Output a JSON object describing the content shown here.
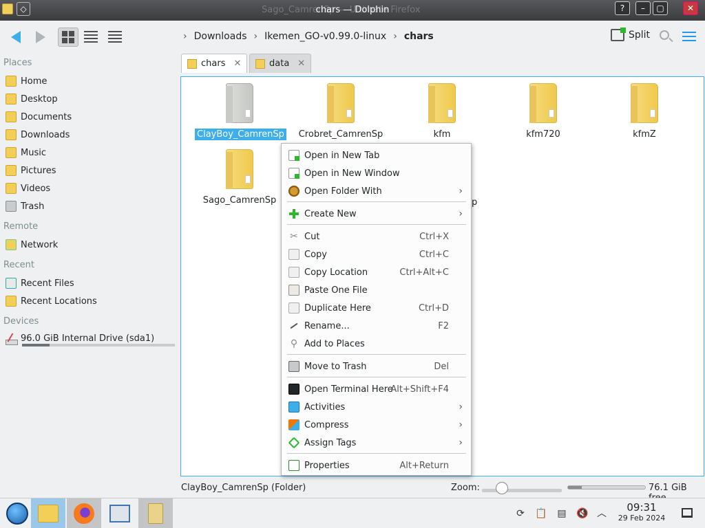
{
  "window": {
    "title": "chars — Dolphin",
    "ghost_title": "Sago_CamrenSp — Ultimate Firefox",
    "pin_label": "◇",
    "help_label": "?",
    "min_label": "–",
    "max_label": "▢",
    "close_label": "✕"
  },
  "toolbar": {
    "breadcrumbs": [
      "Downloads",
      "Ikemen_GO-v0.99.0-linux",
      "chars"
    ],
    "crumb_separator": "›",
    "split_label": "Split"
  },
  "sidebar": {
    "places_header": "Places",
    "places": [
      {
        "label": "Home",
        "icon": "home-folder-icon"
      },
      {
        "label": "Desktop",
        "icon": "desktop-folder-icon"
      },
      {
        "label": "Documents",
        "icon": "documents-folder-icon"
      },
      {
        "label": "Downloads",
        "icon": "downloads-folder-icon"
      },
      {
        "label": "Music",
        "icon": "music-folder-icon"
      },
      {
        "label": "Pictures",
        "icon": "pictures-folder-icon"
      },
      {
        "label": "Videos",
        "icon": "videos-folder-icon"
      },
      {
        "label": "Trash",
        "icon": "trash-icon"
      }
    ],
    "remote_header": "Remote",
    "remote": [
      {
        "label": "Network",
        "icon": "network-folder-icon"
      }
    ],
    "recent_header": "Recent",
    "recent": [
      {
        "label": "Recent Files",
        "icon": "recent-files-icon"
      },
      {
        "label": "Recent Locations",
        "icon": "recent-locations-icon"
      }
    ],
    "devices_header": "Devices",
    "devices": [
      {
        "label": "96.0 GiB Internal Drive (sda1)",
        "icon": "drive-icon",
        "usage_fraction": 0.18
      }
    ]
  },
  "tabs": [
    {
      "label": "chars",
      "active": true,
      "close": "✕"
    },
    {
      "label": "data",
      "active": false,
      "close": "✕"
    }
  ],
  "files": [
    {
      "name": "ClayBoy_CamrenSp",
      "selected": true
    },
    {
      "name": "Crobret_CamrenSp",
      "selected": false
    },
    {
      "name": "kfm",
      "selected": false
    },
    {
      "name": "kfm720",
      "selected": false
    },
    {
      "name": "kfmZ",
      "selected": false
    },
    {
      "name": "Sago_CamrenSp",
      "selected": false
    }
  ],
  "hidden_label_fragment": "p",
  "context_menu": {
    "items": [
      {
        "label": "Open in New Tab",
        "shortcut": "",
        "submenu": false,
        "icon": "open-new-tab-icon"
      },
      {
        "label": "Open in New Window",
        "shortcut": "",
        "submenu": false,
        "icon": "open-new-window-icon"
      },
      {
        "label": "Open Folder With",
        "shortcut": "",
        "submenu": true,
        "icon": "open-with-icon"
      },
      {
        "label": "Create New",
        "shortcut": "",
        "submenu": true,
        "icon": "create-new-icon"
      },
      {
        "label": "Cut",
        "shortcut": "Ctrl+X",
        "submenu": false,
        "icon": "cut-icon"
      },
      {
        "label": "Copy",
        "shortcut": "Ctrl+C",
        "submenu": false,
        "icon": "copy-icon"
      },
      {
        "label": "Copy Location",
        "shortcut": "Ctrl+Alt+C",
        "submenu": false,
        "icon": "copy-location-icon"
      },
      {
        "label": "Paste One File",
        "shortcut": "",
        "submenu": false,
        "icon": "paste-icon"
      },
      {
        "label": "Duplicate Here",
        "shortcut": "Ctrl+D",
        "submenu": false,
        "icon": "duplicate-icon"
      },
      {
        "label": "Rename...",
        "shortcut": "F2",
        "submenu": false,
        "icon": "rename-icon"
      },
      {
        "label": "Add to Places",
        "shortcut": "",
        "submenu": false,
        "icon": "add-to-places-icon"
      },
      {
        "label": "Move to Trash",
        "shortcut": "Del",
        "submenu": false,
        "icon": "move-to-trash-icon"
      },
      {
        "label": "Open Terminal Here",
        "shortcut": "Alt+Shift+F4",
        "submenu": false,
        "icon": "terminal-icon"
      },
      {
        "label": "Activities",
        "shortcut": "",
        "submenu": true,
        "icon": "activities-icon"
      },
      {
        "label": "Compress",
        "shortcut": "",
        "submenu": true,
        "icon": "compress-icon"
      },
      {
        "label": "Assign Tags",
        "shortcut": "",
        "submenu": true,
        "icon": "tags-icon"
      },
      {
        "label": "Properties",
        "shortcut": "Alt+Return",
        "submenu": false,
        "icon": "properties-icon"
      }
    ],
    "submenu_arrow": "›"
  },
  "statusbar": {
    "selection_text": "ClayBoy_CamrenSp (Folder)",
    "zoom_label": "Zoom:",
    "free_space": "76.1 GiB free",
    "free_fraction": 0.18,
    "zoom_fraction": 0.25
  },
  "taskbar": {
    "clock_time": "09:31",
    "clock_date": "29 Feb 2024",
    "tray_icons": [
      "updates-icon",
      "clipboard-icon",
      "notes-icon",
      "volume-muted-icon",
      "expand-tray-icon"
    ],
    "tray_glyphs": [
      "⟳",
      "📋",
      "▤",
      "🔇",
      "︿"
    ]
  },
  "colors": {
    "accent": "#3daee9",
    "folder": "#f3cf57",
    "selection": "#3daee9"
  }
}
